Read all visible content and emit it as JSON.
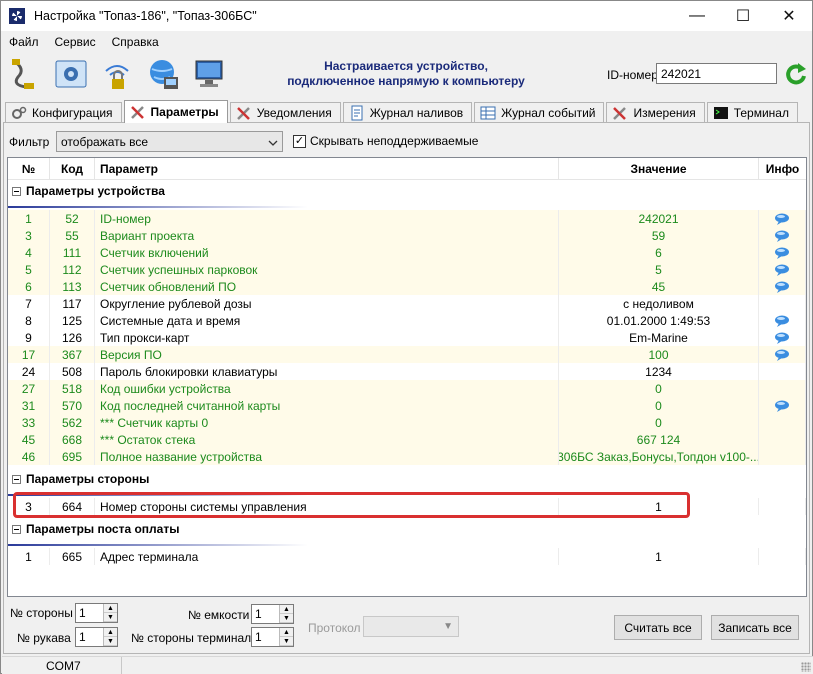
{
  "window": {
    "title": "Настройка \"Топаз-186\", \"Топаз-306БС\"",
    "minimize": "—",
    "maximize": "☐",
    "close": "✕"
  },
  "menu": [
    "Файл",
    "Сервис",
    "Справка"
  ],
  "toolbar": {
    "icons": [
      "connect-cable-icon",
      "settings-panel-icon",
      "wifi-lock-icon",
      "globe-network-icon",
      "monitor-icon"
    ],
    "status_message": "Настраивается устройство,\nподключенное напрямую к компьютеру",
    "id_label": "ID-номер",
    "id_value": "242021"
  },
  "tabs": [
    {
      "label": "Конфигурация",
      "icon": "gears-icon",
      "active": false
    },
    {
      "label": "Параметры",
      "icon": "tools-icon",
      "active": true
    },
    {
      "label": "Уведомления",
      "icon": "tools-icon",
      "active": false
    },
    {
      "label": "Журнал наливов",
      "icon": "document-icon",
      "active": false
    },
    {
      "label": "Журнал событий",
      "icon": "table-icon",
      "active": false
    },
    {
      "label": "Измерения",
      "icon": "tools-icon",
      "active": false
    },
    {
      "label": "Терминал",
      "icon": "terminal-icon",
      "active": false
    }
  ],
  "filter": {
    "label": "Фильтр",
    "selected": "отображать все",
    "hide_unsupported_label": "Скрывать неподдерживаемые",
    "hide_unsupported_checked": true
  },
  "grid": {
    "columns": {
      "num": "№",
      "code": "Код",
      "param": "Параметр",
      "value": "Значение",
      "info": "Инфо"
    },
    "groups": [
      {
        "title": "Параметры устройства",
        "rows": [
          {
            "num": "1",
            "code": "52",
            "param": "ID-номер",
            "value": "242021",
            "info": true,
            "green": true
          },
          {
            "num": "3",
            "code": "55",
            "param": "Вариант проекта",
            "value": "59",
            "info": true,
            "green": true
          },
          {
            "num": "4",
            "code": "111",
            "param": "Счетчик включений",
            "value": "6",
            "info": true,
            "green": true
          },
          {
            "num": "5",
            "code": "112",
            "param": "Счетчик успешных парковок",
            "value": "5",
            "info": true,
            "green": true
          },
          {
            "num": "6",
            "code": "113",
            "param": "Счетчик обновлений ПО",
            "value": "45",
            "info": true,
            "green": true
          },
          {
            "num": "7",
            "code": "117",
            "param": "Округление рублевой дозы",
            "value": "с недоливом",
            "info": false,
            "green": false
          },
          {
            "num": "8",
            "code": "125",
            "param": "Системные дата и время",
            "value": "01.01.2000 1:49:53",
            "info": true,
            "green": false
          },
          {
            "num": "9",
            "code": "126",
            "param": "Тип прокси-карт",
            "value": "Em-Marine",
            "info": true,
            "green": false
          },
          {
            "num": "17",
            "code": "367",
            "param": "Версия ПО",
            "value": "100",
            "info": true,
            "green": true
          },
          {
            "num": "24",
            "code": "508",
            "param": "Пароль блокировки клавиатуры",
            "value": "1234",
            "info": false,
            "green": false
          },
          {
            "num": "27",
            "code": "518",
            "param": "Код ошибки устройства",
            "value": "0",
            "info": false,
            "green": true
          },
          {
            "num": "31",
            "code": "570",
            "param": "Код последней считанной карты",
            "value": "0",
            "info": true,
            "green": true
          },
          {
            "num": "33",
            "code": "562",
            "param": "*** Счетчик карты 0",
            "value": "0",
            "info": false,
            "green": true
          },
          {
            "num": "45",
            "code": "668",
            "param": "*** Остаток стека",
            "value": "667 124",
            "info": false,
            "green": true
          },
          {
            "num": "46",
            "code": "695",
            "param": "Полное название устройства",
            "value": "306БС Заказ,Бонусы,Топдон v100-...",
            "info": false,
            "green": true
          }
        ]
      },
      {
        "title": "Параметры стороны",
        "rows": [
          {
            "num": "3",
            "code": "664",
            "param": "Номер стороны системы управления",
            "value": "1",
            "info": false,
            "green": false
          }
        ]
      },
      {
        "title": "Параметры поста оплаты",
        "rows": [
          {
            "num": "1",
            "code": "665",
            "param": "Адрес терминала",
            "value": "1",
            "info": false,
            "green": false
          }
        ]
      }
    ]
  },
  "bottom": {
    "side_no_label": "№ стороны",
    "side_no_value": "1",
    "sleeve_no_label": "№ рукава",
    "sleeve_no_value": "1",
    "tank_no_label": "№ емкости",
    "tank_no_value": "1",
    "term_side_label": "№ стороны терминала",
    "term_side_value": "1",
    "protocol_label": "Протокол",
    "read_all": "Считать все",
    "write_all": "Записать все"
  },
  "statusbar": {
    "port": "COM7"
  },
  "colors": {
    "green_text": "#1c8a1c",
    "alt_row": "#fffbe9",
    "highlight": "#d93030",
    "title_blue": "#1a2a7a"
  }
}
